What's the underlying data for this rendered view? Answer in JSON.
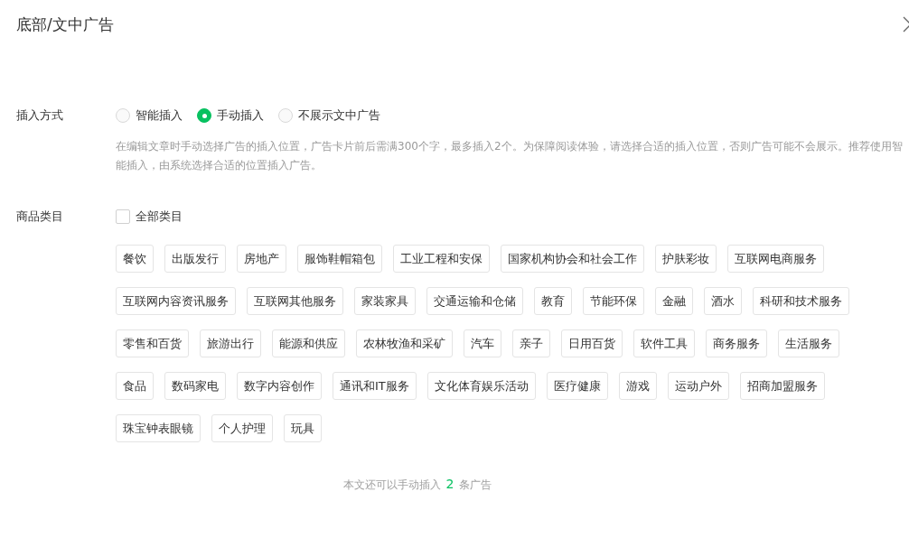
{
  "dialog": {
    "title": "底部/文中广告"
  },
  "insert_mode": {
    "label": "插入方式",
    "options": [
      {
        "label": "智能插入",
        "selected": false
      },
      {
        "label": "手动插入",
        "selected": true
      },
      {
        "label": "不展示文中广告",
        "selected": false
      }
    ],
    "description": "在编辑文章时手动选择广告的插入位置，广告卡片前后需满300个字，最多插入2个。为保障阅读体验，请选择合适的插入位置，否则广告可能不会展示。推荐使用智能插入，由系统选择合适的位置插入广告。"
  },
  "categories": {
    "label": "商品类目",
    "all": {
      "label": "全部类目",
      "checked": false
    },
    "tags": [
      "餐饮",
      "出版发行",
      "房地产",
      "服饰鞋帽箱包",
      "工业工程和安保",
      "国家机构协会和社会工作",
      "护肤彩妆",
      "互联网电商服务",
      "互联网内容资讯服务",
      "互联网其他服务",
      "家装家具",
      "交通运输和仓储",
      "教育",
      "节能环保",
      "金融",
      "酒水",
      "科研和技术服务",
      "零售和百货",
      "旅游出行",
      "能源和供应",
      "农林牧渔和采矿",
      "汽车",
      "亲子",
      "日用百货",
      "软件工具",
      "商务服务",
      "生活服务",
      "食品",
      "数码家电",
      "数字内容创作",
      "通讯和IT服务",
      "文化体育娱乐活动",
      "医疗健康",
      "游戏",
      "运动户外",
      "招商加盟服务",
      "珠宝钟表眼镜",
      "个人护理",
      "玩具"
    ]
  },
  "footer": {
    "before": "本文还可以手动插入",
    "count": "2",
    "after": "条广告"
  }
}
